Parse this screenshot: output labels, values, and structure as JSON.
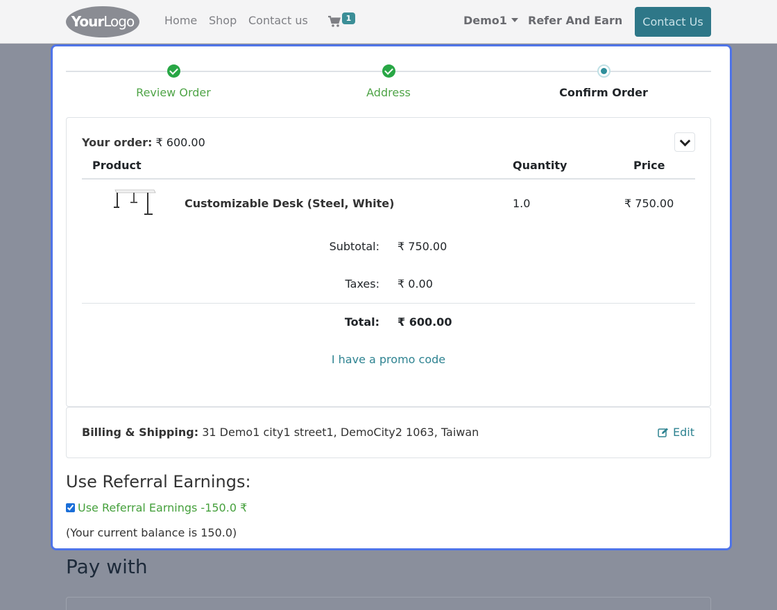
{
  "navbar": {
    "logo_text_bold": "Your",
    "logo_text": "Logo",
    "links": [
      "Home",
      "Shop",
      "Contact us"
    ],
    "cart_count": "1",
    "user": "Demo1",
    "refer": "Refer And Earn",
    "contact_button": "Contact Us"
  },
  "steps": [
    {
      "label": "Review Order",
      "state": "done"
    },
    {
      "label": "Address",
      "state": "done"
    },
    {
      "label": "Confirm Order",
      "state": "current"
    }
  ],
  "order": {
    "your_order_label": "Your order:",
    "your_order_value": "₹ 600.00",
    "headers": {
      "product": "Product",
      "quantity": "Quantity",
      "price": "Price"
    },
    "line": {
      "name": "Customizable Desk (Steel, White)",
      "quantity": "1.0",
      "price": "₹ 750.00"
    },
    "subtotal_label": "Subtotal:",
    "subtotal_value": "₹ 750.00",
    "taxes_label": "Taxes:",
    "taxes_value": "₹ 0.00",
    "total_label": "Total:",
    "total_value": "₹ 600.00",
    "promo_link": "I have a promo code"
  },
  "billing": {
    "label": "Billing & Shipping:",
    "address": "31 Demo1 city1 street1, DemoCity2 1063, Taiwan",
    "edit_label": "Edit"
  },
  "referral": {
    "title": "Use Referral Earnings:",
    "checkbox_label": "Use Referral Earnings -150.0 ₹",
    "checked": true,
    "balance": "(Your current balance is 150.0)"
  },
  "payment": {
    "title": "Pay with"
  },
  "colors": {
    "accent": "#2e7788",
    "success": "#28a745",
    "modal_border": "#4f74e8",
    "backdrop": "#8a8f9c"
  }
}
